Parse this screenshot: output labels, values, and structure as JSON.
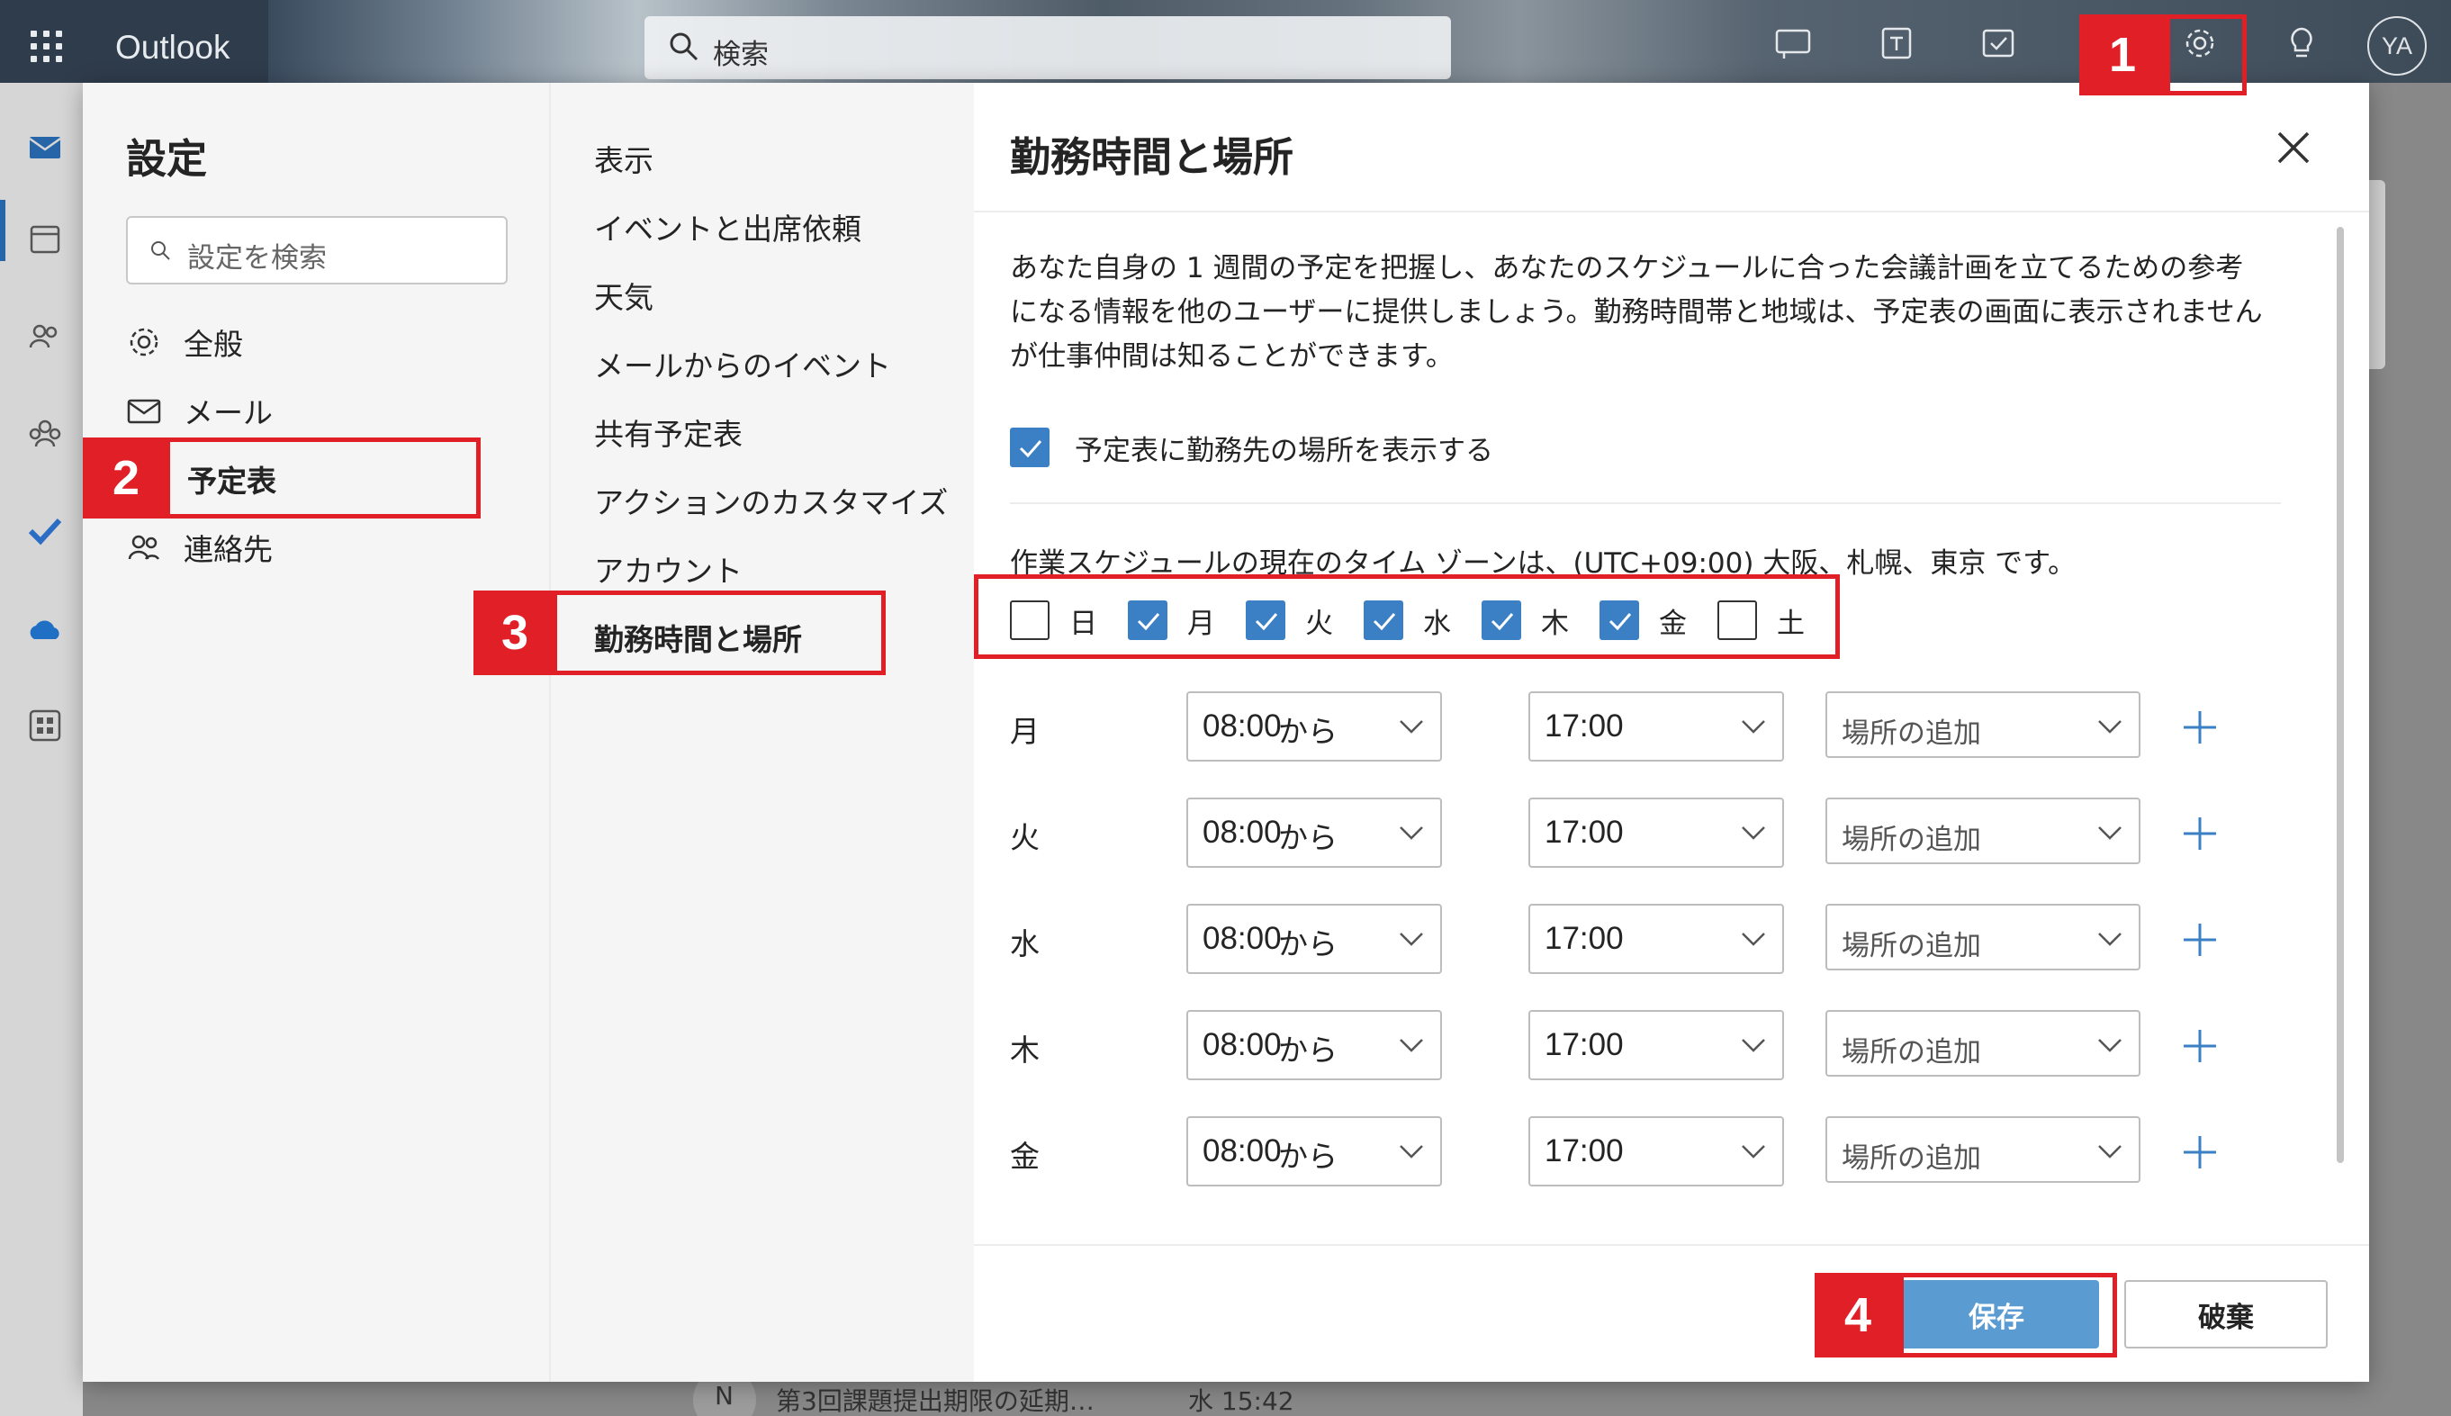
{
  "app": {
    "name": "Outlook",
    "search_placeholder": "検索",
    "avatar_initials": "YA"
  },
  "settings": {
    "title": "設定",
    "search_placeholder": "設定を検索",
    "categories": [
      {
        "label": "全般",
        "icon": "gear-icon"
      },
      {
        "label": "メール",
        "icon": "mail-icon"
      },
      {
        "label": "予定表",
        "icon": "calendar-icon",
        "selected": true
      },
      {
        "label": "連絡先",
        "icon": "people-icon"
      }
    ],
    "subitems": [
      {
        "label": "表示"
      },
      {
        "label": "イベントと出席依頼"
      },
      {
        "label": "天気"
      },
      {
        "label": "メールからのイベント"
      },
      {
        "label": "共有予定表"
      },
      {
        "label": "アクションのカスタマイズ"
      },
      {
        "label": "アカウント"
      },
      {
        "label": "勤務時間と場所",
        "selected": true
      }
    ]
  },
  "panel": {
    "title": "勤務時間と場所",
    "description": "あなた自身の 1 週間の予定を把握し、あなたのスケジュールに合った会議計画を立てるための参考になる情報を他のユーザーに提供しましょう。勤務時間帯と地域は、予定表の画面に表示されませんが仕事仲間は知ることができます。",
    "show_location_label": "予定表に勤務先の場所を表示する",
    "show_location_checked": true,
    "timezone_text": "作業スケジュールの現在のタイム ゾーンは、(UTC+09:00) 大阪、札幌、東京 です。",
    "days": [
      {
        "label": "日",
        "checked": false
      },
      {
        "label": "月",
        "checked": true
      },
      {
        "label": "火",
        "checked": true
      },
      {
        "label": "水",
        "checked": true
      },
      {
        "label": "木",
        "checked": true
      },
      {
        "label": "金",
        "checked": true
      },
      {
        "label": "土",
        "checked": false
      }
    ],
    "schedule": [
      {
        "day": "月",
        "start": "08:00",
        "sep": "から",
        "end": "17:00",
        "location": "場所の追加"
      },
      {
        "day": "火",
        "start": "08:00",
        "sep": "から",
        "end": "17:00",
        "location": "場所の追加"
      },
      {
        "day": "水",
        "start": "08:00",
        "sep": "から",
        "end": "17:00",
        "location": "場所の追加"
      },
      {
        "day": "木",
        "start": "08:00",
        "sep": "から",
        "end": "17:00",
        "location": "場所の追加"
      },
      {
        "day": "金",
        "start": "08:00",
        "sep": "から",
        "end": "17:00",
        "location": "場所の追加"
      }
    ],
    "save_label": "保存",
    "discard_label": "破棄"
  },
  "background": {
    "mail_avatar": "N",
    "mail_subject": "第3回課題提出期限の延期…",
    "mail_time": "水 15:42"
  },
  "callouts": [
    "1",
    "2",
    "3",
    "4"
  ],
  "colors": {
    "accent": "#3b7fc4",
    "save_button": "#5a9bd2",
    "callout": "#e11f26"
  }
}
